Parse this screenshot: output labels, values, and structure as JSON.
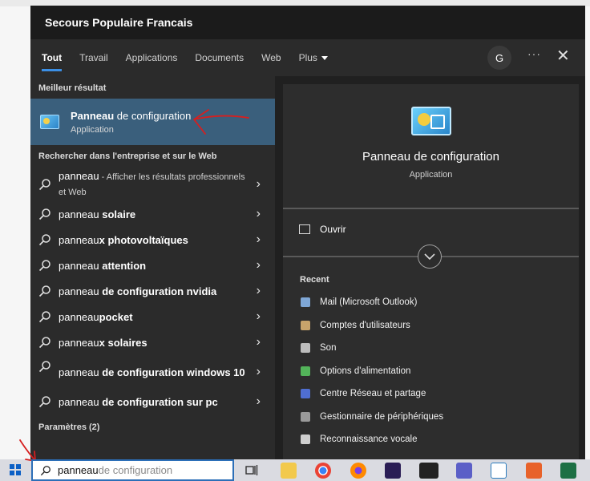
{
  "window": {
    "title": "Secours Populaire Francais"
  },
  "tabs": [
    {
      "label": "Tout",
      "active": true
    },
    {
      "label": "Travail"
    },
    {
      "label": "Applications"
    },
    {
      "label": "Documents"
    },
    {
      "label": "Web"
    },
    {
      "label": "Plus"
    }
  ],
  "header": {
    "avatar_letter": "G",
    "more_label": "···",
    "close_label": "✕"
  },
  "left": {
    "best_header": "Meilleur résultat",
    "best": {
      "name_bold": "Panneau",
      "name_rest": " de configuration",
      "type": "Application"
    },
    "web_header": "Rechercher dans l'entreprise et sur le Web",
    "web_results": [
      {
        "pre": "panneau",
        "bold": "",
        "sub": " - Afficher les résultats professionnels et Web"
      },
      {
        "pre": "panneau",
        "bold": " solaire"
      },
      {
        "pre": "panneau",
        "bold": "x photovoltaïques"
      },
      {
        "pre": "panneau",
        "bold": " attention"
      },
      {
        "pre": "panneau",
        "bold": " de configuration nvidia"
      },
      {
        "pre": "panneau",
        "bold": "pocket"
      },
      {
        "pre": "panneau",
        "bold": "x solaires"
      },
      {
        "pre": "panneau",
        "bold": " de configuration windows 10"
      },
      {
        "pre": "panneau",
        "bold": " de configuration sur pc"
      }
    ],
    "settings_header": "Paramètres (2)"
  },
  "right": {
    "title": "Panneau de configuration",
    "subtitle": "Application",
    "open_label": "Ouvrir",
    "recent_header": "Recent",
    "recent": [
      {
        "label": "Mail (Microsoft Outlook)",
        "color": "#7fa7d6"
      },
      {
        "label": "Comptes d'utilisateurs",
        "color": "#c7a36b"
      },
      {
        "label": "Son",
        "color": "#bdbdbd"
      },
      {
        "label": "Options d'alimentation",
        "color": "#53b45a"
      },
      {
        "label": "Centre Réseau et partage",
        "color": "#4f6ed1"
      },
      {
        "label": "Gestionnaire de périphériques",
        "color": "#9a9a9a"
      },
      {
        "label": "Reconnaissance vocale",
        "color": "#cfcfcf"
      }
    ]
  },
  "taskbar": {
    "search_typed": "panneau",
    "search_suggestion": " de configuration"
  },
  "colors": {
    "accent": "#3b8fe5",
    "selected_row": "#3a5f7c",
    "annotation": "#d61f1f"
  }
}
